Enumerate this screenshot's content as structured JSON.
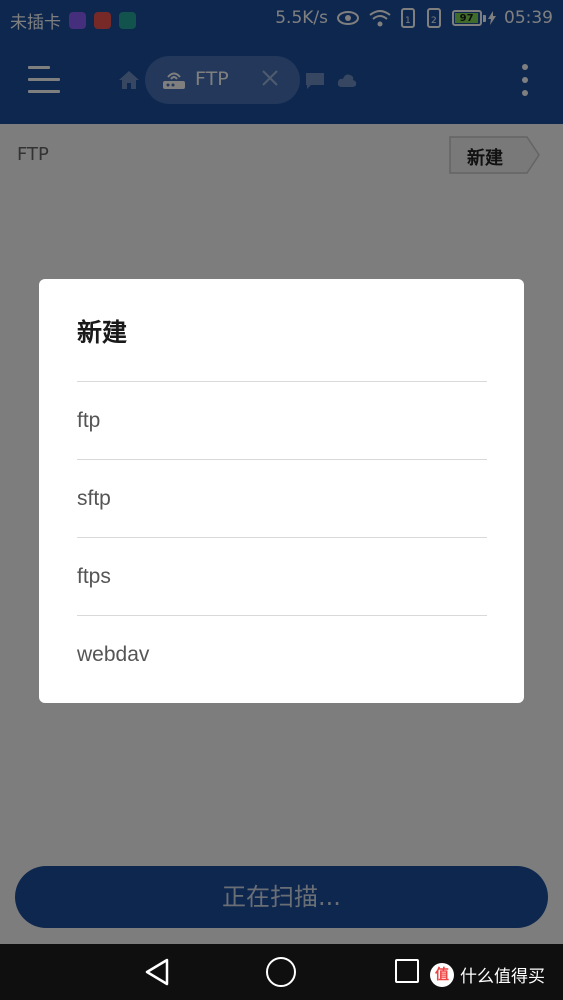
{
  "status_bar": {
    "carrier": "未插卡",
    "speed": "5.5K/s",
    "battery": "97",
    "battery_level": 0.97,
    "time": "05:39"
  },
  "toolbar": {
    "tab_label": "FTP"
  },
  "content": {
    "breadcrumb": "FTP",
    "new_button": "新建",
    "scan_button": "正在扫描..."
  },
  "dialog": {
    "title": "新建",
    "options": [
      "ftp",
      "sftp",
      "ftps",
      "webdav"
    ]
  },
  "navbar": {
    "watermark": "什么值得买",
    "watermark_logo": "值"
  },
  "colors": {
    "primary": "#1d4f9f",
    "tab_pill": "#4670b5",
    "battery_green": "#7ed957"
  }
}
